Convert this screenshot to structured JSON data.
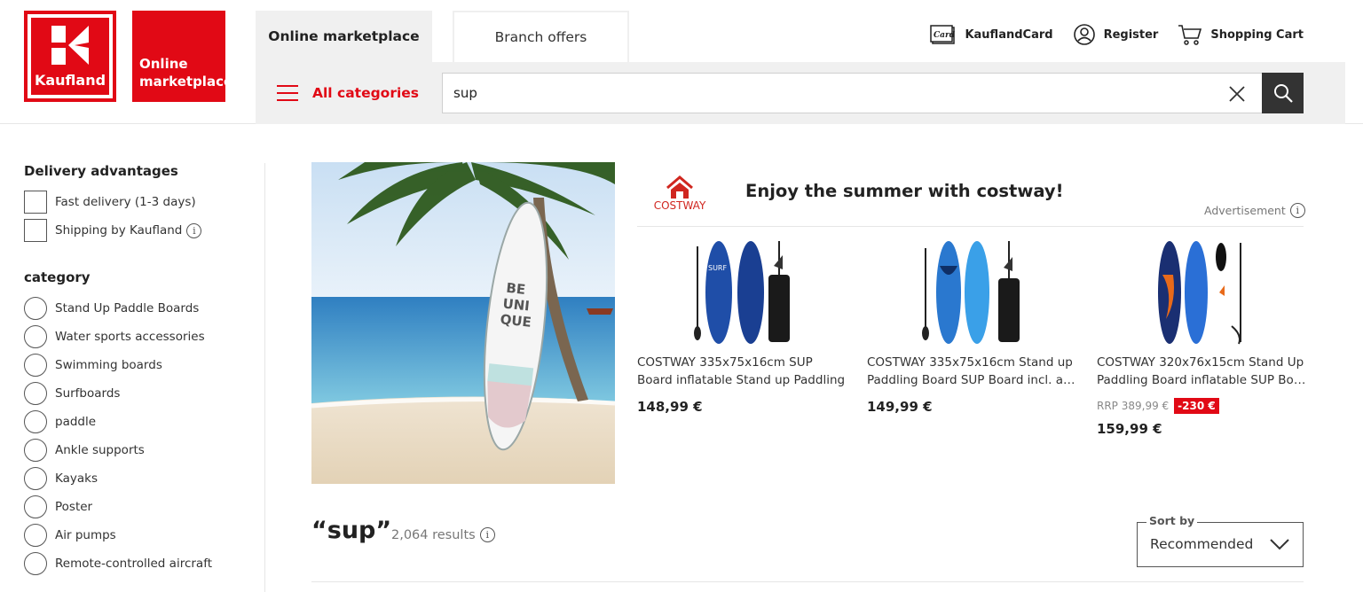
{
  "brand": {
    "logo_text": "Kaufland",
    "sub_logo_line1": "Online",
    "sub_logo_line2": "marketplace"
  },
  "tabs": [
    {
      "label": "Online marketplace",
      "active": true
    },
    {
      "label": "Branch offers",
      "active": false
    }
  ],
  "top_links": {
    "card": "KauflandCard",
    "register": "Register",
    "cart": "Shopping Cart"
  },
  "search": {
    "all_categories": "All categories",
    "query": "sup"
  },
  "sidebar": {
    "delivery_heading": "Delivery advantages",
    "delivery_options": [
      {
        "label": "Fast delivery (1-3 days)",
        "info": false
      },
      {
        "label": "Shipping by Kaufland",
        "info": true
      }
    ],
    "category_heading": "category",
    "categories": [
      "Stand Up Paddle Boards",
      "Water sports accessories",
      "Swimming boards",
      "Surfboards",
      "paddle",
      "Ankle supports",
      "Kayaks",
      "Poster",
      "Air pumps",
      "Remote-controlled aircraft"
    ]
  },
  "ad": {
    "brand_name": "COSTWAY",
    "title": "Enjoy the summer with costway!",
    "label": "Advertisement",
    "products": [
      {
        "name_line1": "COSTWAY 335x75x16cm SUP",
        "name_line2": "Board inflatable Stand up Paddling",
        "price": "148,99 €",
        "rrp": "",
        "discount": ""
      },
      {
        "name_line1": "COSTWAY 335x75x16cm Stand up",
        "name_line2": "Paddling Board SUP Board incl. accessories",
        "price": "149,99 €",
        "rrp": "",
        "discount": ""
      },
      {
        "name_line1": "COSTWAY 320x76x15cm Stand Up",
        "name_line2": "Paddling Board inflatable SUP Board",
        "price": "159,99 €",
        "rrp": "RRP 389,99 €",
        "discount": "-230 €"
      }
    ]
  },
  "results": {
    "query": "“sup”",
    "count": "2,064 results",
    "sort_label": "Sort by",
    "sort_value": "Recommended"
  },
  "colors": {
    "brand_red": "#e10915",
    "dark": "#333333",
    "band": "#f0f0f0"
  }
}
